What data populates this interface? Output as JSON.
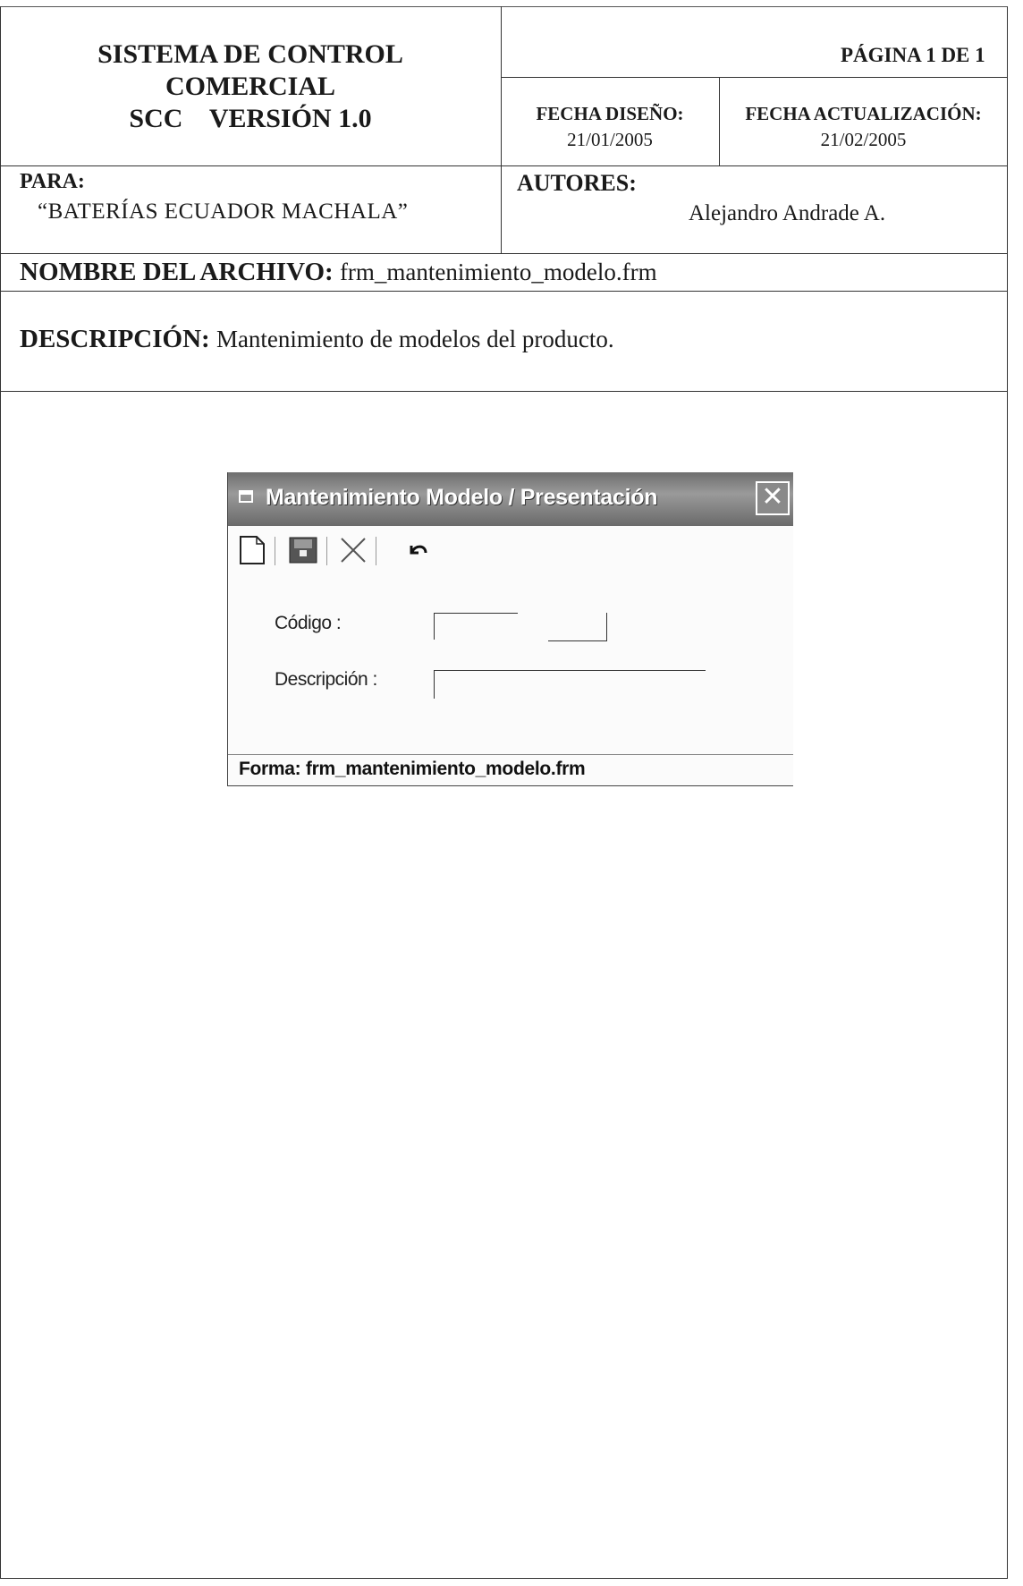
{
  "header": {
    "system_line1": "SISTEMA DE CONTROL",
    "system_line2": "COMERCIAL",
    "system_line3": "SCC    VERSIÓN 1.0",
    "page_label": "PÁGINA 1 DE 1",
    "design_date_label": "FECHA DISEÑO:",
    "design_date": "21/01/2005",
    "update_date_label": "FECHA ACTUALIZACIÓN:",
    "update_date": "21/02/2005"
  },
  "for": {
    "label": "PARA:",
    "value": "“BATERÍAS ECUADOR MACHALA”"
  },
  "authors": {
    "label": "AUTORES:",
    "value": "Alejandro Andrade A."
  },
  "file": {
    "label": "NOMBRE DEL ARCHIVO:",
    "value": "frm_mantenimiento_modelo.frm"
  },
  "description": {
    "label": "DESCRIPCIÓN:",
    "value": "Mantenimiento de modelos del producto."
  },
  "window": {
    "title": "Mantenimiento Modelo / Presentación",
    "close_glyph": "✕",
    "toolbar": {
      "new_icon": "new-document-icon",
      "save_icon": "save-icon",
      "delete_icon": "delete-icon",
      "undo_icon": "undo-icon"
    },
    "code_label": "Código :",
    "code_value": "",
    "code_lookup_value": "",
    "description_label": "Descripción :",
    "description_value": "",
    "status_text": "Forma: frm_mantenimiento_modelo.frm"
  }
}
